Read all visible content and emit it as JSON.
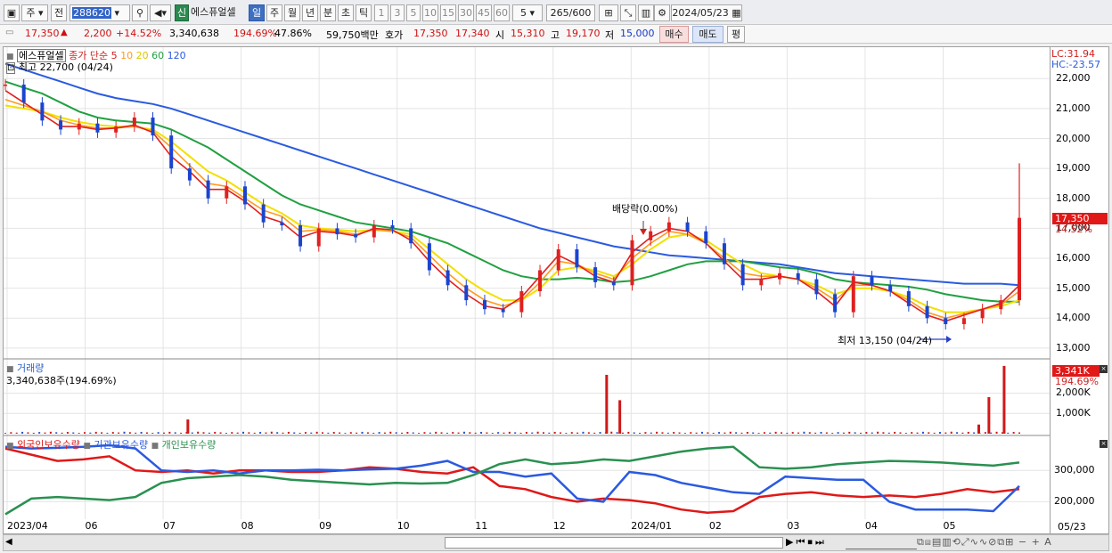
{
  "toolbar": {
    "period_unit": "주",
    "price_basis": "전",
    "code": "288620",
    "new_badge": "신",
    "stock_name": "에스퓨얼셀",
    "tabs": [
      "일",
      "주",
      "월",
      "년",
      "분",
      "초",
      "틱"
    ],
    "active_tab": "일",
    "minute_opts": [
      "1",
      "3",
      "5",
      "10",
      "15",
      "30",
      "45",
      "60"
    ],
    "interval_value": "5",
    "count": "265/600",
    "date": "2024/05/23"
  },
  "quote": {
    "price": "17,350",
    "change": "2,200",
    "change_pct": "+14.52%",
    "volume": "3,340,638",
    "vol_ratio": "194.69%",
    "turnover_pct": "47.86%",
    "amount": "59,750백만",
    "bid_label": "호가",
    "bid": "17,350",
    "ask": "17,340",
    "open_label": "시",
    "open": "15,310",
    "high_label": "고",
    "high": "19,170",
    "low_label": "저",
    "low": "15,000",
    "buy_label": "매수",
    "sell_label": "매도",
    "eval_label": "평"
  },
  "price_panel": {
    "title": "에스퓨얼셀",
    "legend_prefix": "종가 단순",
    "ma_labels": [
      "5",
      "10",
      "20",
      "60",
      "120"
    ],
    "ma_colors": [
      "#e02020",
      "#ff9a20",
      "#f2e000",
      "#20a040",
      "#2a5ae0"
    ],
    "high_note": "최고 22,700 (04/24)",
    "low_note": "최저 13,150 (04/24)",
    "dividend_note": "배당락(0.00%)",
    "lc": "LC:31.94",
    "hc": "HC:-23.57",
    "last_price_tag": "17,350",
    "last_pct_tag": "14.52%",
    "y_ticks": [
      "22,000",
      "21,000",
      "20,000",
      "19,000",
      "18,000",
      "17,000",
      "16,000",
      "15,000",
      "14,000",
      "13,000"
    ]
  },
  "volume_panel": {
    "title": "거래량",
    "value_note": "3,340,638주(194.69%)",
    "last_tag": "3,341K",
    "last_pct": "194.69%",
    "y_ticks": [
      "2,000K",
      "1,000K"
    ]
  },
  "holdings_panel": {
    "legend": [
      "외국인보유수량",
      "기관보유수량",
      "개인보유수량"
    ],
    "colors": [
      "#e01818",
      "#2a5ae0",
      "#2a9050"
    ],
    "y_ticks": [
      "300,000",
      "200,000"
    ]
  },
  "x_labels": [
    "2023/04",
    "06",
    "07",
    "08",
    "09",
    "10",
    "11",
    "12",
    "2024/01",
    "02",
    "03",
    "04",
    "05"
  ],
  "x_end_label": "05/23",
  "chart_data": {
    "type": "line",
    "title": "에스퓨얼셀",
    "ylim": [
      12700,
      22900
    ],
    "series": [
      {
        "name": "종가",
        "values": [
          21800,
          21200,
          20600,
          20300,
          20500,
          20200,
          20400,
          20700,
          20100,
          19000,
          18600,
          18000,
          18400,
          17800,
          17200,
          17100,
          16400,
          17000,
          16800,
          16700,
          17100,
          17000,
          16500,
          15600,
          15100,
          14600,
          14300,
          14200,
          14900,
          15600,
          16300,
          15700,
          15200,
          15100,
          16600,
          16900,
          17200,
          16900,
          16500,
          15800,
          15100,
          15300,
          15500,
          15300,
          14800,
          14200,
          15400,
          15100,
          14900,
          14400,
          14000,
          13800,
          14000,
          14300,
          14600,
          17350
        ]
      },
      {
        "name": "5",
        "values": [
          21600,
          21200,
          20800,
          20400,
          20400,
          20300,
          20350,
          20450,
          20200,
          19400,
          18900,
          18300,
          18300,
          17900,
          17400,
          17200,
          16700,
          16900,
          16850,
          16750,
          17000,
          16950,
          16600,
          15900,
          15300,
          14800,
          14400,
          14300,
          14700,
          15400,
          16100,
          15800,
          15400,
          15200,
          16200,
          16700,
          17000,
          16900,
          16500,
          15900,
          15300,
          15300,
          15400,
          15300,
          14900,
          14400,
          15200,
          15100,
          14900,
          14500,
          14100,
          13900,
          14100,
          14300,
          14500,
          15100
        ]
      },
      {
        "name": "10",
        "values": [
          21300,
          21100,
          20900,
          20600,
          20450,
          20350,
          20350,
          20400,
          20250,
          19700,
          19100,
          18500,
          18400,
          18000,
          17600,
          17400,
          16900,
          16950,
          16900,
          16800,
          16950,
          16900,
          16700,
          16100,
          15500,
          15000,
          14600,
          14400,
          14600,
          15200,
          15900,
          15800,
          15500,
          15300,
          16000,
          16500,
          16900,
          16800,
          16500,
          16000,
          15500,
          15400,
          15400,
          15300,
          15000,
          14600,
          15100,
          15100,
          14900,
          14600,
          14200,
          14000,
          14150,
          14300,
          14450,
          14900
        ]
      },
      {
        "name": "20",
        "values": [
          21100,
          21000,
          20900,
          20700,
          20550,
          20450,
          20400,
          20400,
          20300,
          19900,
          19400,
          18900,
          18600,
          18200,
          17800,
          17500,
          17100,
          17000,
          16950,
          16900,
          16950,
          16900,
          16800,
          16300,
          15800,
          15300,
          14900,
          14600,
          14600,
          15000,
          15600,
          15700,
          15600,
          15400,
          15800,
          16300,
          16700,
          16800,
          16600,
          16200,
          15800,
          15500,
          15400,
          15300,
          15100,
          14800,
          15000,
          15000,
          14900,
          14700,
          14400,
          14200,
          14200,
          14300,
          14400,
          14600
        ]
      },
      {
        "name": "60",
        "values": [
          21900,
          21700,
          21500,
          21200,
          20900,
          20700,
          20600,
          20550,
          20500,
          20300,
          20000,
          19700,
          19300,
          18900,
          18500,
          18100,
          17800,
          17600,
          17400,
          17200,
          17100,
          17000,
          16900,
          16700,
          16500,
          16200,
          15900,
          15600,
          15400,
          15300,
          15300,
          15350,
          15300,
          15200,
          15250,
          15400,
          15600,
          15800,
          15900,
          15900,
          15900,
          15800,
          15700,
          15650,
          15500,
          15300,
          15200,
          15150,
          15100,
          15050,
          14950,
          14800,
          14700,
          14600,
          14550,
          14550
        ]
      },
      {
        "name": "120",
        "values": [
          22500,
          22300,
          22100,
          21900,
          21700,
          21500,
          21350,
          21250,
          21150,
          21000,
          20800,
          20600,
          20400,
          20200,
          20000,
          19800,
          19600,
          19400,
          19200,
          19000,
          18800,
          18600,
          18400,
          18200,
          18000,
          17800,
          17600,
          17400,
          17200,
          17000,
          16850,
          16700,
          16550,
          16400,
          16300,
          16200,
          16100,
          16050,
          16000,
          15950,
          15900,
          15850,
          15800,
          15700,
          15600,
          15500,
          15450,
          15400,
          15350,
          15300,
          15250,
          15200,
          15150,
          15150,
          15150,
          15100
        ]
      }
    ],
    "volume": {
      "name": "거래량",
      "ylim": [
        0,
        3600
      ],
      "bars": [
        [
          0.18,
          700
        ],
        [
          0.593,
          2900
        ],
        [
          0.606,
          1650
        ],
        [
          0.96,
          450
        ],
        [
          0.97,
          1800
        ],
        [
          0.985,
          3341
        ]
      ]
    },
    "holdings": {
      "ylim": [
        150000,
        400000
      ],
      "series": [
        {
          "name": "외국인보유수량",
          "values": [
            370000,
            350000,
            330000,
            335000,
            345000,
            300000,
            295000,
            300000,
            290000,
            300000,
            300000,
            295000,
            295000,
            300000,
            310000,
            305000,
            295000,
            290000,
            310000,
            250000,
            240000,
            215000,
            200000,
            210000,
            205000,
            195000,
            175000,
            165000,
            170000,
            215000,
            225000,
            230000,
            220000,
            215000,
            220000,
            215000,
            225000,
            240000,
            230000,
            240000
          ]
        },
        {
          "name": "기관보유수량",
          "values": [
            375000,
            370000,
            372000,
            375000,
            380000,
            370000,
            300000,
            295000,
            300000,
            290000,
            300000,
            300000,
            302000,
            300000,
            303000,
            305000,
            315000,
            330000,
            295000,
            295000,
            280000,
            290000,
            210000,
            200000,
            295000,
            285000,
            260000,
            245000,
            230000,
            225000,
            280000,
            275000,
            270000,
            270000,
            200000,
            175000,
            175000,
            175000,
            170000,
            250000
          ]
        },
        {
          "name": "개인보유수량",
          "values": [
            160000,
            210000,
            215000,
            210000,
            205000,
            215000,
            260000,
            275000,
            280000,
            285000,
            280000,
            270000,
            265000,
            260000,
            255000,
            260000,
            258000,
            260000,
            285000,
            320000,
            335000,
            320000,
            325000,
            335000,
            330000,
            345000,
            360000,
            370000,
            375000,
            310000,
            305000,
            310000,
            320000,
            325000,
            330000,
            328000,
            325000,
            320000,
            315000,
            325000
          ]
        }
      ]
    }
  }
}
